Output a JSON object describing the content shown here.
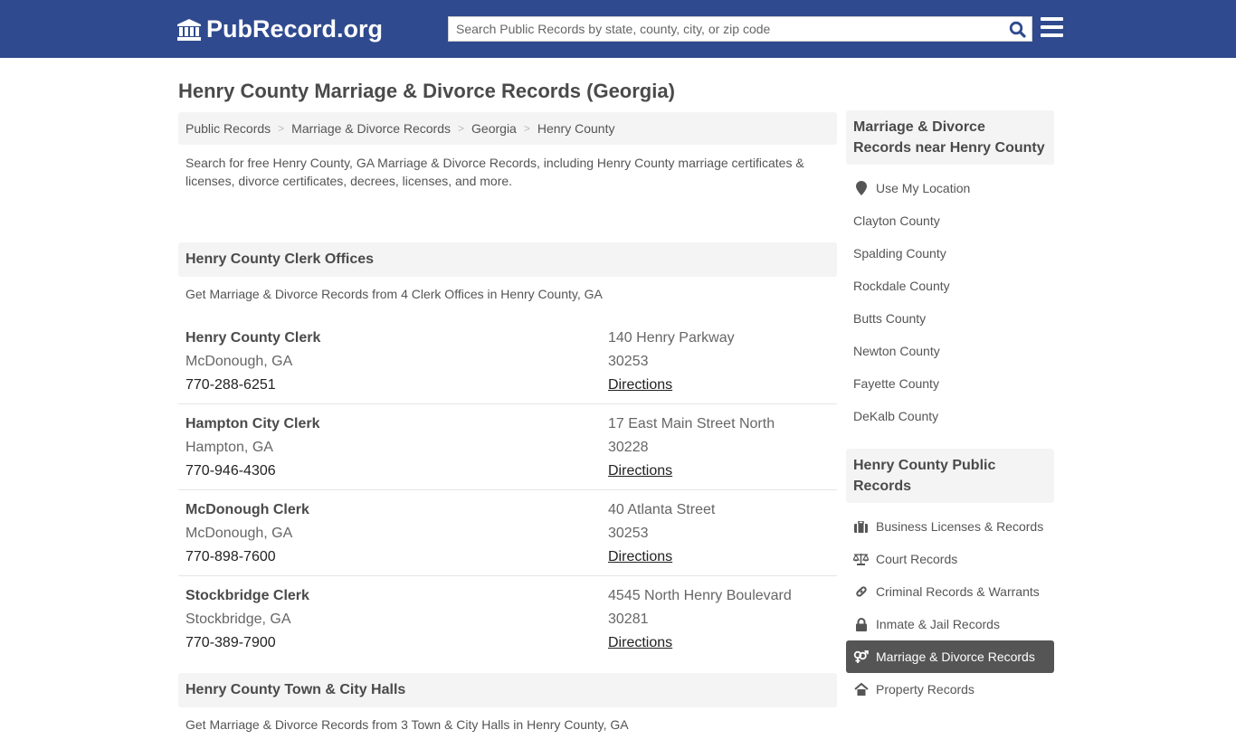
{
  "header": {
    "logo_text": "PubRecord.org",
    "search_placeholder": "Search Public Records by state, county, city, or zip code"
  },
  "page_title": "Henry County Marriage & Divorce Records (Georgia)",
  "breadcrumb": [
    "Public Records",
    "Marriage & Divorce Records",
    "Georgia",
    "Henry County"
  ],
  "intro": "Search for free Henry County, GA Marriage & Divorce Records, including Henry County marriage certificates & licenses, divorce certificates, decrees, licenses, and more.",
  "sections": [
    {
      "title": "Henry County Clerk Offices",
      "subtitle": "Get Marriage & Divorce Records from 4 Clerk Offices in Henry County, GA",
      "records": [
        {
          "name": "Henry County Clerk",
          "city": "McDonough, GA",
          "phone": "770-288-6251",
          "address": "140 Henry Parkway",
          "zip": "30253",
          "link": "Directions"
        },
        {
          "name": "Hampton City Clerk",
          "city": "Hampton, GA",
          "phone": "770-946-4306",
          "address": "17 East Main Street North",
          "zip": "30228",
          "link": "Directions"
        },
        {
          "name": "McDonough Clerk",
          "city": "McDonough, GA",
          "phone": "770-898-7600",
          "address": "40 Atlanta Street",
          "zip": "30253",
          "link": "Directions"
        },
        {
          "name": "Stockbridge Clerk",
          "city": "Stockbridge, GA",
          "phone": "770-389-7900",
          "address": "4545 North Henry Boulevard",
          "zip": "30281",
          "link": "Directions"
        }
      ]
    },
    {
      "title": "Henry County Town & City Halls",
      "subtitle": "Get Marriage & Divorce Records from 3 Town & City Halls in Henry County, GA"
    }
  ],
  "sidebar": {
    "nearby": {
      "title": "Marriage & Divorce Records near Henry County",
      "items": [
        {
          "label": "Use My Location",
          "icon": "map-marker-icon"
        },
        {
          "label": "Clayton County"
        },
        {
          "label": "Spalding County"
        },
        {
          "label": "Rockdale County"
        },
        {
          "label": "Butts County"
        },
        {
          "label": "Newton County"
        },
        {
          "label": "Fayette County"
        },
        {
          "label": "DeKalb County"
        }
      ]
    },
    "public_records": {
      "title": "Henry County Public Records",
      "items": [
        {
          "label": "Business Licenses & Records",
          "icon": "briefcase-icon"
        },
        {
          "label": "Court Records",
          "icon": "balance-scale-icon"
        },
        {
          "label": "Criminal Records & Warrants",
          "icon": "link-icon"
        },
        {
          "label": "Inmate & Jail Records",
          "icon": "lock-icon"
        },
        {
          "label": "Marriage & Divorce Records",
          "icon": "venus-mars-icon",
          "active": true
        },
        {
          "label": "Property Records",
          "icon": "home-icon"
        }
      ]
    }
  },
  "colors": {
    "header_bg": "#2f4a8e",
    "active_bg": "#555555",
    "search_icon": "#2f4a8e"
  }
}
